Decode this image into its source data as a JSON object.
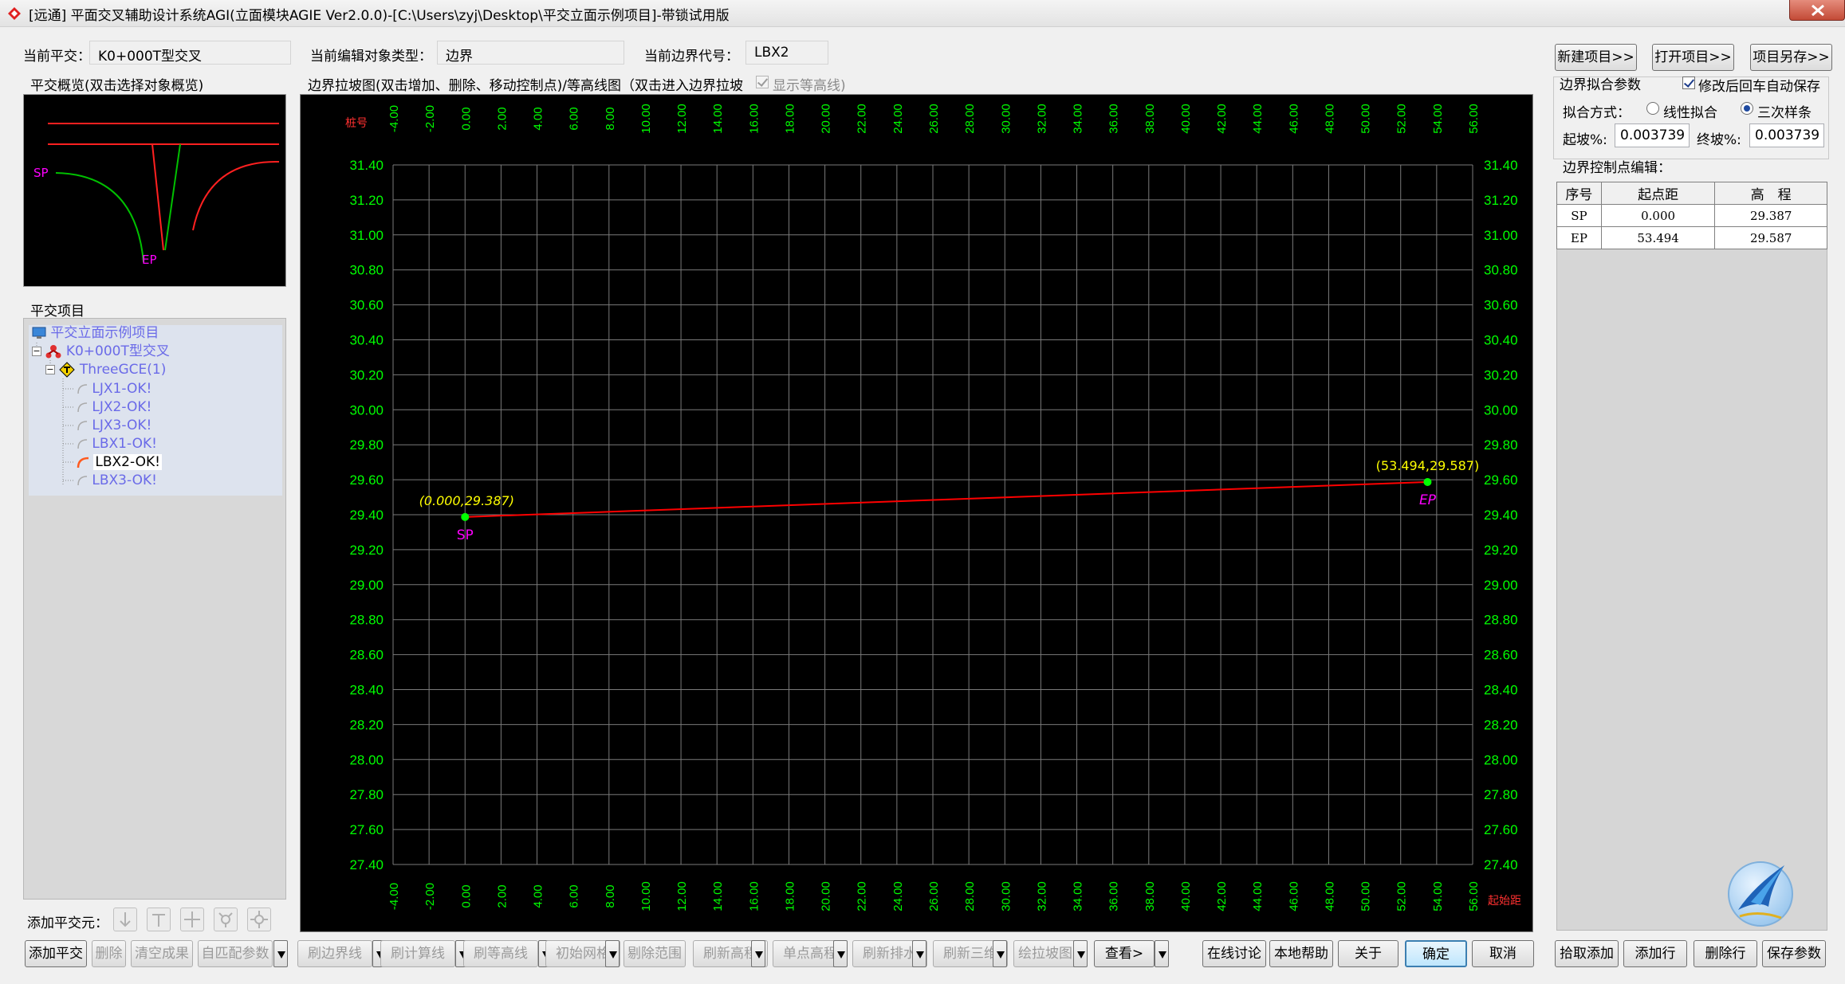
{
  "window": {
    "title": "[远通] 平面交叉辅助设计系统AGI(立面模块AGIE Ver2.0.0)-[C:\\Users\\zyj\\Desktop\\平交立面示例项目]-带锁试用版"
  },
  "header": {
    "current_junction_label": "当前平交：",
    "current_junction_value": "K0+000T型交叉",
    "edit_type_label": "当前编辑对象类型：",
    "edit_type_value": "边界",
    "boundary_code_label": "当前边界代号：",
    "boundary_code_value": "LBX2"
  },
  "overview": {
    "title": "平交概览(双击选择对象概览)",
    "sp_label": "SP",
    "ep_label": "EP"
  },
  "tree": {
    "title": "平交项目",
    "items": [
      {
        "label": "平交立面示例项目",
        "level": 0
      },
      {
        "label": "K0+000T型交叉",
        "level": 1
      },
      {
        "label": "ThreeGCE(1)",
        "level": 2
      },
      {
        "label": "LJX1-OK!",
        "level": 3
      },
      {
        "label": "LJX2-OK!",
        "level": 3
      },
      {
        "label": "LJX3-OK!",
        "level": 3
      },
      {
        "label": "LBX1-OK!",
        "level": 3
      },
      {
        "label": "LBX2-OK!",
        "level": 3,
        "selected": true
      },
      {
        "label": "LBX3-OK!",
        "level": 3
      }
    ]
  },
  "add_elements": {
    "label": "添加平交元：",
    "icons": [
      "arrow-down-icon",
      "t-junction-icon",
      "cross-junction-icon",
      "y-junction-icon",
      "roundabout-icon"
    ]
  },
  "chart_header": {
    "title": "边界拉坡图(双击增加、删除、移动控制点)/等高线图（双击进入边界拉坡",
    "show_contours_label": "显示等高线)",
    "show_contours_checked": true
  },
  "chart_data": {
    "type": "line",
    "top_axis_label": "桩号",
    "bottom_axis_label": "起始距",
    "xlim": [
      -4,
      56
    ],
    "ylim": [
      27.4,
      31.4
    ],
    "x_ticks": [
      "-4.00",
      "-2.00",
      "0.00",
      "2.00",
      "4.00",
      "6.00",
      "8.00",
      "10.00",
      "12.00",
      "14.00",
      "16.00",
      "18.00",
      "20.00",
      "22.00",
      "24.00",
      "26.00",
      "28.00",
      "30.00",
      "32.00",
      "34.00",
      "36.00",
      "38.00",
      "40.00",
      "42.00",
      "44.00",
      "46.00",
      "48.00",
      "50.00",
      "52.00",
      "54.00",
      "56.00"
    ],
    "y_ticks": [
      "31.40",
      "31.20",
      "31.00",
      "30.80",
      "30.60",
      "30.40",
      "30.20",
      "30.00",
      "29.80",
      "29.60",
      "29.40",
      "29.20",
      "29.00",
      "28.80",
      "28.60",
      "28.40",
      "28.20",
      "28.00",
      "27.80",
      "27.60",
      "27.40"
    ],
    "points": [
      {
        "name": "SP",
        "x": 0.0,
        "y": 29.387,
        "annotation": "(0.000,29.387)"
      },
      {
        "name": "EP",
        "x": 53.494,
        "y": 29.587,
        "annotation": "(53.494,29.587)"
      }
    ],
    "grid": true,
    "colors": {
      "background": "#000000",
      "grid": "#7a7a7a",
      "tick_labels": "#00ff00",
      "axis_title": "#ff3030",
      "line": "#ff0000",
      "points": "#00ff00",
      "point_labels": "#ff00ff",
      "annotations": "#ffff00"
    }
  },
  "right_panel": {
    "new_project": "新建项目>>",
    "open_project": "打开项目>>",
    "save_as": "项目另存>>",
    "fit_params_title": "边界拟合参数",
    "auto_save_label": "修改后回车自动保存",
    "auto_save_checked": true,
    "fit_method_label": "拟合方式：",
    "fit_linear": "线性拟合",
    "fit_cubic": "三次样条",
    "fit_selected": "三次样条",
    "start_slope_label": "起坡%:",
    "start_slope_value": "0.003739",
    "end_slope_label": "终坡%:",
    "end_slope_value": "0.003739",
    "ctrl_edit_title": "边界控制点编辑：",
    "table_headers": [
      "序号",
      "起点距",
      "高　程"
    ],
    "table_rows": [
      [
        "SP",
        "0.000",
        "29.387"
      ],
      [
        "EP",
        "53.494",
        "29.587"
      ]
    ]
  },
  "bottom_toolbar": {
    "add_junction": "添加平交",
    "delete": "删除",
    "clear_results": "清空成果",
    "auto_match": "自匹配参数",
    "refresh_boundary": "刷边界线",
    "refresh_calc": "刷计算线",
    "refresh_contour": "刷等高线",
    "init_grid": "初始网格",
    "remove_range": "剔除范围",
    "refresh_elevation": "刷新高程",
    "single_elevation": "单点高程",
    "refresh_drainage": "刷新排水",
    "refresh_3d": "刷新三维",
    "draw_profile": "绘拉坡图",
    "view": "查看>",
    "online_discuss": "在线讨论",
    "local_help": "本地帮助",
    "about": "关于",
    "ok": "确定",
    "cancel": "取消",
    "pick_add": "拾取添加",
    "add_row": "添加行",
    "delete_row": "删除行",
    "save_params": "保存参数"
  }
}
